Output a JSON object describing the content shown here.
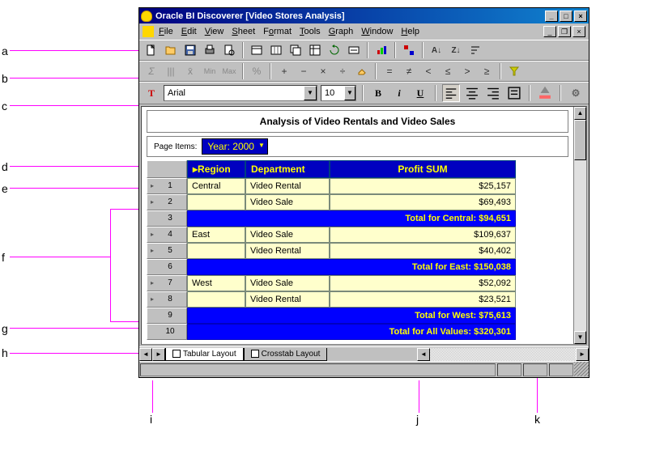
{
  "window": {
    "title": "Oracle BI Discoverer  [Video Stores Analysis]"
  },
  "menus": {
    "file": "File",
    "edit": "Edit",
    "view": "View",
    "sheet": "Sheet",
    "format": "Format",
    "tools": "Tools",
    "graph": "Graph",
    "window": "Window",
    "help": "Help"
  },
  "format": {
    "font": "Arial",
    "size": "10"
  },
  "report": {
    "title": "Analysis of Video Rentals and Video Sales"
  },
  "page_items": {
    "label": "Page Items:",
    "value": "Year: 2000"
  },
  "columns": {
    "region": "Region",
    "department": "Department",
    "profit": "Profit SUM"
  },
  "rows": [
    {
      "n": "1",
      "region": "Central",
      "dept": "Video Rental",
      "profit": "$25,157",
      "type": "data"
    },
    {
      "n": "2",
      "region": "",
      "dept": "Video Sale",
      "profit": "$69,493",
      "type": "data"
    },
    {
      "n": "3",
      "text": "Total for Central: $94,651",
      "type": "total"
    },
    {
      "n": "4",
      "region": "East",
      "dept": "Video Sale",
      "profit": "$109,637",
      "type": "data"
    },
    {
      "n": "5",
      "region": "",
      "dept": "Video Rental",
      "profit": "$40,402",
      "type": "data"
    },
    {
      "n": "6",
      "text": "Total for East: $150,038",
      "type": "total"
    },
    {
      "n": "7",
      "region": "West",
      "dept": "Video Sale",
      "profit": "$52,092",
      "type": "data"
    },
    {
      "n": "8",
      "region": "",
      "dept": "Video Rental",
      "profit": "$23,521",
      "type": "data"
    },
    {
      "n": "9",
      "text": "Total for West: $75,613",
      "type": "total"
    },
    {
      "n": "10",
      "text": "Total for All Values: $320,301",
      "type": "total"
    }
  ],
  "tabs": {
    "tab1": "Tabular Layout",
    "tab2": "Crosstab Layout"
  },
  "callouts": {
    "a": "a",
    "b": "b",
    "c": "c",
    "d": "d",
    "e": "e",
    "f": "f",
    "g": "g",
    "h": "h",
    "i": "i",
    "j": "j",
    "k": "k"
  },
  "analysis_labels": {
    "sum": "Σ",
    "count": "|||",
    "avg": "x̄",
    "min": "Min",
    "max": "Max",
    "pct": "%"
  },
  "ops": {
    "plus": "+",
    "minus": "−",
    "mult": "×",
    "div": "÷",
    "eq": "=",
    "neq": "≠",
    "lt": "<",
    "lte": "≤",
    "gt": ">",
    "gte": "≥"
  }
}
